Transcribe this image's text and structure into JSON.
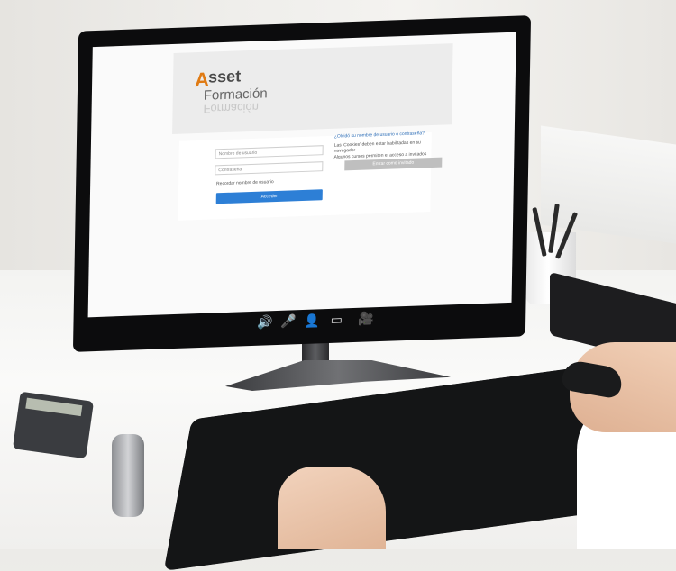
{
  "screen": {
    "logo": {
      "a": "A",
      "sset": "sset",
      "formacion": "Formación"
    },
    "username_placeholder": "Nombre de usuario",
    "password_placeholder": "Contraseña",
    "remember_text": "Recordar nombre de usuario",
    "login_button": "Acceder",
    "forgot_text": "¿Olvidó su nombre de usuario o contraseña?",
    "cookies_text": "Las 'Cookies' deben estar habilitadas en su navegador",
    "guest_text": "Algunos cursos permiten el acceso a invitados",
    "guest_button": "Entrar como invitado"
  },
  "controls": [
    {
      "name": "speaker-icon",
      "glyph": "🔊"
    },
    {
      "name": "microphone-icon",
      "glyph": "🎤"
    },
    {
      "name": "user-icon",
      "glyph": "👤"
    },
    {
      "name": "screen-icon",
      "glyph": "▭"
    },
    {
      "name": "camera-icon",
      "glyph": "🎥"
    }
  ],
  "colors": {
    "accent": "#e07b14",
    "button": "#2d7fd6",
    "frame": "#0c0c0d"
  }
}
